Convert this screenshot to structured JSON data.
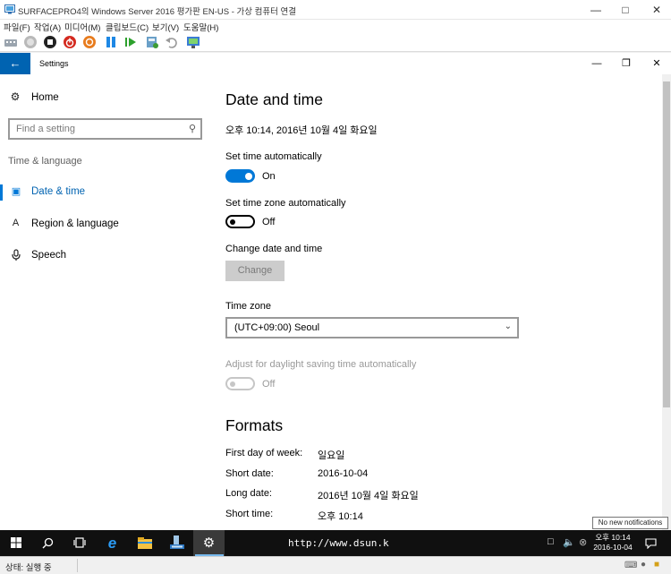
{
  "host": {
    "title": "SURFACEPRO4의 Windows Server 2016 평가판 EN-US - 가상 컴퓨터 연결",
    "menu": [
      "파일(F)",
      "작업(A)",
      "미디어(M)",
      "클립보드(C)",
      "보기(V)",
      "도움말(H)"
    ],
    "status": "상태: 실행 중"
  },
  "settings": {
    "window_title": "Settings",
    "nav": {
      "home": "Home",
      "search_placeholder": "Find a setting",
      "section": "Time & language",
      "items": [
        {
          "label": "Date & time",
          "icon": "calendar-clock-icon",
          "active": true
        },
        {
          "label": "Region & language",
          "icon": "language-icon",
          "active": false
        },
        {
          "label": "Speech",
          "icon": "microphone-icon",
          "active": false
        }
      ]
    },
    "content": {
      "heading": "Date and time",
      "current_datetime": "오후 10:14, 2016년 10월 4일 화요일",
      "set_time_auto": {
        "label": "Set time automatically",
        "state": "On",
        "on": true
      },
      "set_tz_auto": {
        "label": "Set time zone automatically",
        "state": "Off",
        "on": false
      },
      "change_label": "Change date and time",
      "change_button": "Change",
      "timezone_label": "Time zone",
      "timezone_value": "(UTC+09:00) Seoul",
      "dst": {
        "label": "Adjust for daylight saving time automatically",
        "state": "Off",
        "enabled": false
      },
      "formats_heading": "Formats",
      "formats": [
        {
          "label": "First day of week:",
          "value": "일요일"
        },
        {
          "label": "Short date:",
          "value": "2016-10-04"
        },
        {
          "label": "Long date:",
          "value": "2016년 10월 4일 화요일"
        },
        {
          "label": "Short time:",
          "value": "오후 10:14"
        }
      ]
    }
  },
  "taskbar": {
    "overlay_text": "http://www.dsun.k",
    "clock_time": "오후 10:14",
    "clock_date": "2016-10-04",
    "notification_tooltip": "No new notifications"
  },
  "colors": {
    "accent": "#0078d7",
    "back_button": "#0063b1",
    "taskbar": "#101010"
  }
}
